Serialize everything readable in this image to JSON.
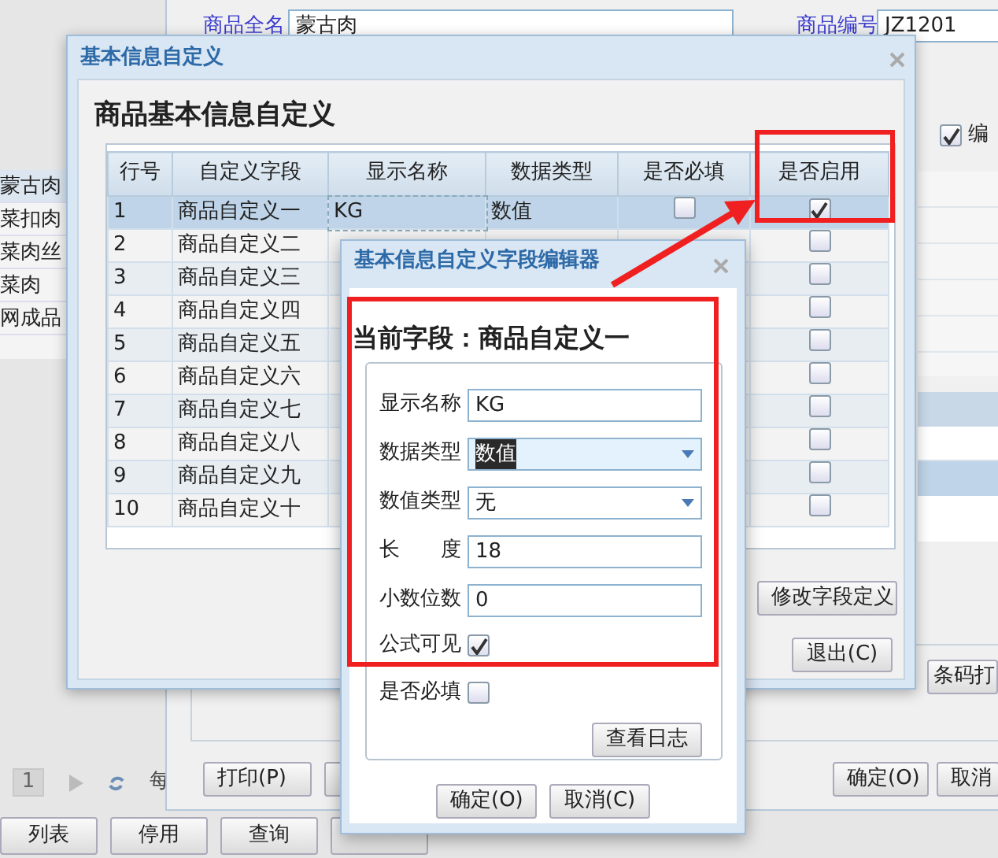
{
  "background_app": {
    "list_items": [
      {
        "text": "蒙古肉",
        "selected": true
      },
      {
        "text": "菜扣肉",
        "selected": false
      },
      {
        "text": "菜肉丝",
        "selected": false
      },
      {
        "text": "菜肉",
        "selected": false
      },
      {
        "text": "网成品",
        "selected": false
      }
    ],
    "pager": {
      "page": "1",
      "per_page_label": "每"
    },
    "bottom_buttons": [
      "列表",
      "停用",
      "查询"
    ]
  },
  "product_window": {
    "fields": [
      {
        "label": "商品全名",
        "value": "蒙古肉"
      },
      {
        "label": "商品编号",
        "value": "JZ1201"
      }
    ],
    "option": {
      "label": "编",
      "checked": true
    },
    "print_button": "打印(P)",
    "ok_button": "确定(O)",
    "cancel_button": "取消",
    "barcode_button": "条码打"
  },
  "custom_dialog": {
    "title": "基本信息自定义",
    "heading": "商品基本信息自定义",
    "columns": [
      "行号",
      "自定义字段",
      "显示名称",
      "数据类型",
      "是否必填",
      "是否启用"
    ],
    "rows": [
      {
        "line": "1",
        "field": "商品自定义一",
        "display_name": "KG",
        "data_type": "数值",
        "required": false,
        "enabled": true,
        "selected": true
      },
      {
        "line": "2",
        "field": "商品自定义二",
        "enabled": false,
        "selected": false
      },
      {
        "line": "3",
        "field": "商品自定义三",
        "enabled": false,
        "selected": false
      },
      {
        "line": "4",
        "field": "商品自定义四",
        "enabled": false,
        "selected": false
      },
      {
        "line": "5",
        "field": "商品自定义五",
        "enabled": false,
        "selected": false
      },
      {
        "line": "6",
        "field": "商品自定义六",
        "enabled": false,
        "selected": false
      },
      {
        "line": "7",
        "field": "商品自定义七",
        "enabled": false,
        "selected": false
      },
      {
        "line": "8",
        "field": "商品自定义八",
        "enabled": false,
        "selected": false
      },
      {
        "line": "9",
        "field": "商品自定义九",
        "enabled": false,
        "selected": false
      },
      {
        "line": "10",
        "field": "商品自定义十",
        "enabled": false,
        "selected": false
      }
    ],
    "modify_button": "修改字段定义",
    "exit_button": "退出(C)"
  },
  "editor_dialog": {
    "title": "基本信息自定义字段编辑器",
    "heading": "当前字段：商品自定义一",
    "fields": [
      {
        "kind": "text",
        "label": "显示名称",
        "value": "KG"
      },
      {
        "kind": "select",
        "label": "数据类型",
        "value": "数值",
        "highlighted": true
      },
      {
        "kind": "select",
        "label": "数值类型",
        "value": "无",
        "highlighted": false
      },
      {
        "kind": "text",
        "label": "长　　度",
        "value": "18"
      },
      {
        "kind": "text",
        "label": "小数位数",
        "value": "0"
      }
    ],
    "checks": [
      {
        "label": "公式可见",
        "checked": true
      },
      {
        "label": "是否必填",
        "checked": false
      }
    ],
    "log_button": "查看日志",
    "ok_button": "确定(O)",
    "cancel_button": "取消(C)"
  }
}
